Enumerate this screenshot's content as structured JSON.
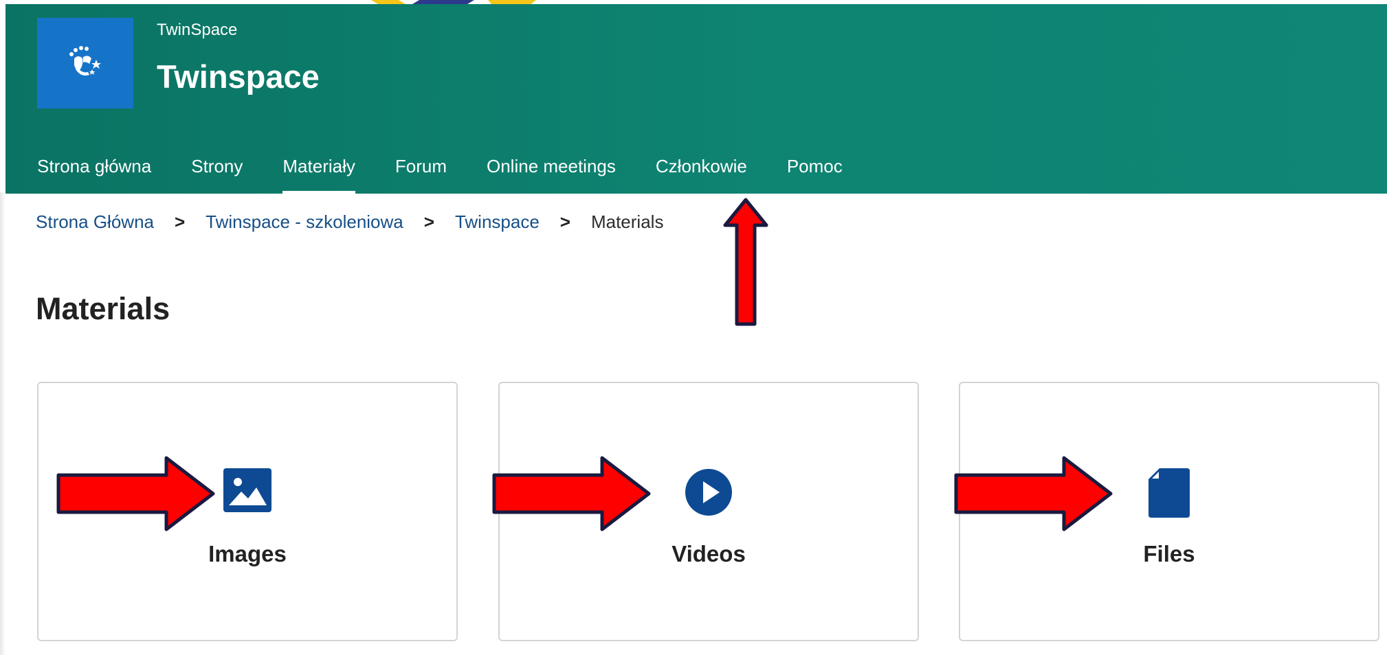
{
  "header": {
    "brand_small": "TwinSpace",
    "brand_title": "Twinspace"
  },
  "nav": {
    "items": [
      {
        "label": "Strona główna"
      },
      {
        "label": "Strony"
      },
      {
        "label": "Materiały"
      },
      {
        "label": "Forum"
      },
      {
        "label": "Online meetings"
      },
      {
        "label": "Członkowie"
      },
      {
        "label": "Pomoc"
      }
    ],
    "active": "Materiały"
  },
  "breadcrumb": {
    "items": [
      "Strona Główna",
      "Twinspace - szkoleniowa",
      "Twinspace",
      "Materials"
    ],
    "separator": ">"
  },
  "page": {
    "title": "Materials"
  },
  "cards": [
    {
      "label": "Images",
      "icon": "image-icon"
    },
    {
      "label": "Videos",
      "icon": "play-circle-icon"
    },
    {
      "label": "Files",
      "icon": "file-icon"
    }
  ],
  "colors": {
    "header_bg": "#0e7e6c",
    "logo_bg": "#1674c8",
    "link": "#174f87",
    "icon": "#0e4a93",
    "annotation_arrow": "#ff0000",
    "annotation_outline": "#1a1a40"
  }
}
